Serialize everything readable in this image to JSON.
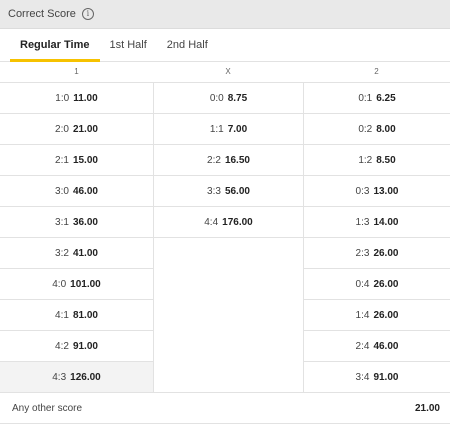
{
  "header": {
    "title": "Correct Score",
    "info_icon": "info-icon"
  },
  "tabs": [
    {
      "label": "Regular Time",
      "active": true
    },
    {
      "label": "1st Half",
      "active": false
    },
    {
      "label": "2nd Half",
      "active": false
    }
  ],
  "columns": [
    "1",
    "X",
    "2"
  ],
  "home": [
    {
      "score": "1:0",
      "odds": "11.00"
    },
    {
      "score": "2:0",
      "odds": "21.00"
    },
    {
      "score": "2:1",
      "odds": "15.00"
    },
    {
      "score": "3:0",
      "odds": "46.00"
    },
    {
      "score": "3:1",
      "odds": "36.00"
    },
    {
      "score": "3:2",
      "odds": "41.00"
    },
    {
      "score": "4:0",
      "odds": "101.00"
    },
    {
      "score": "4:1",
      "odds": "81.00"
    },
    {
      "score": "4:2",
      "odds": "91.00"
    },
    {
      "score": "4:3",
      "odds": "126.00"
    }
  ],
  "draw": [
    {
      "score": "0:0",
      "odds": "8.75"
    },
    {
      "score": "1:1",
      "odds": "7.00"
    },
    {
      "score": "2:2",
      "odds": "16.50"
    },
    {
      "score": "3:3",
      "odds": "56.00"
    },
    {
      "score": "4:4",
      "odds": "176.00"
    }
  ],
  "away": [
    {
      "score": "0:1",
      "odds": "6.25"
    },
    {
      "score": "0:2",
      "odds": "8.00"
    },
    {
      "score": "1:2",
      "odds": "8.50"
    },
    {
      "score": "0:3",
      "odds": "13.00"
    },
    {
      "score": "1:3",
      "odds": "14.00"
    },
    {
      "score": "2:3",
      "odds": "26.00"
    },
    {
      "score": "0:4",
      "odds": "26.00"
    },
    {
      "score": "1:4",
      "odds": "26.00"
    },
    {
      "score": "2:4",
      "odds": "46.00"
    },
    {
      "score": "3:4",
      "odds": "91.00"
    }
  ],
  "footer": {
    "label": "Any other score",
    "odds": "21.00"
  },
  "colors": {
    "accent": "#f6c200",
    "header_bg": "#e9e9e9"
  }
}
